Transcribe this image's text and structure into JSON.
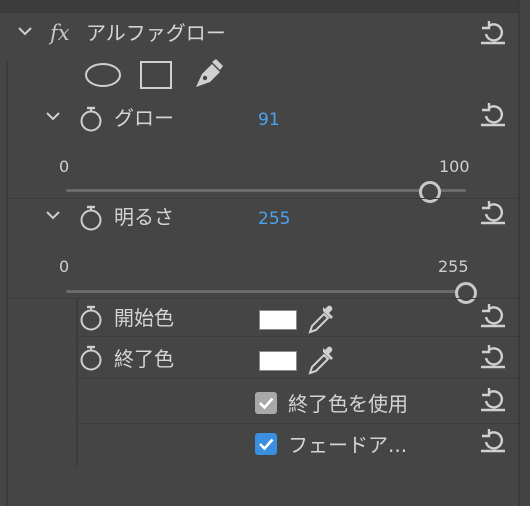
{
  "effect": {
    "fx_label": "fx",
    "name": "アルファグロー",
    "mask_tools": [
      "ellipse-mask-icon",
      "rectangle-mask-icon",
      "pen-mask-icon"
    ]
  },
  "glow": {
    "label": "グロー",
    "value": "91",
    "slider_min": "0",
    "slider_max": "100",
    "slider_fraction": 0.91
  },
  "brightness": {
    "label": "明るさ",
    "value": "255",
    "slider_min": "0",
    "slider_max": "255",
    "slider_fraction": 1.0
  },
  "start_color": {
    "label": "開始色",
    "color": "#ffffff"
  },
  "end_color": {
    "label": "終了色",
    "color": "#ffffff"
  },
  "use_end_color": {
    "label": "終了色を使用",
    "checked": true
  },
  "fade_out": {
    "label": "フェードア...",
    "checked": true
  },
  "colors": {
    "accent": "#4aa3ee",
    "checkbox_on": "#3a8fe0",
    "checkbox_off": "#a8a8a8"
  }
}
